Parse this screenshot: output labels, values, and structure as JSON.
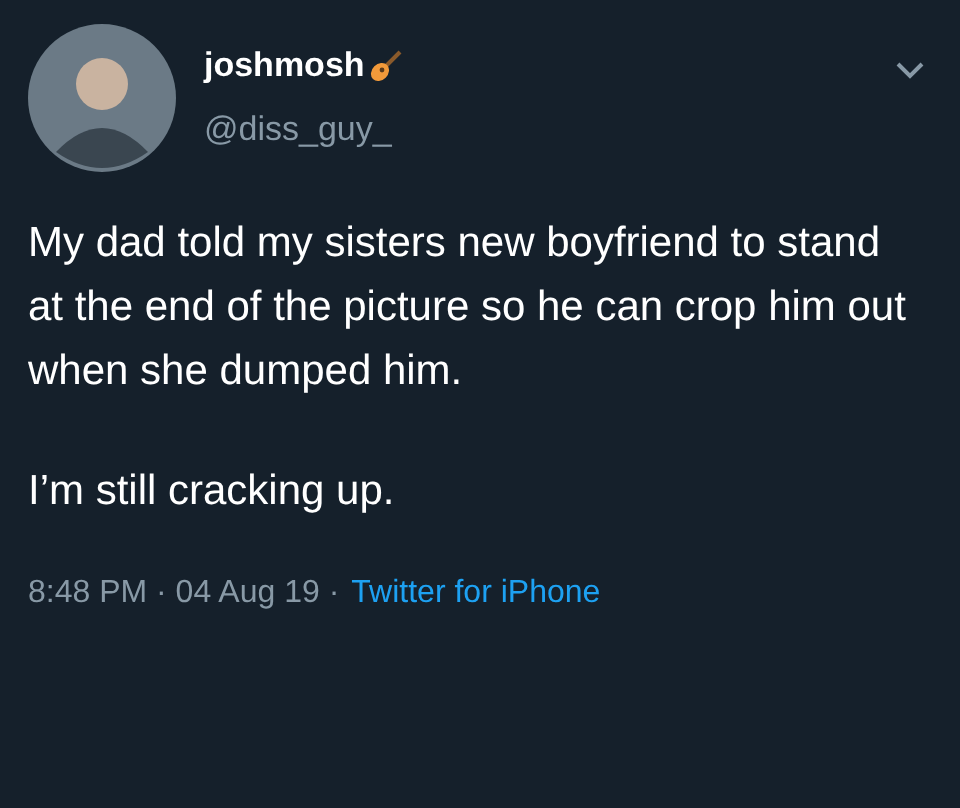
{
  "author": {
    "name": "joshmosh",
    "handle": "@diss_guy_"
  },
  "tweet": {
    "paragraphs": [
      "My dad told my sisters new boyfriend to stand at the end of the picture so he can crop him out when she dumped him.",
      "I’m still cracking up."
    ]
  },
  "meta": {
    "time": "8:48 PM · 04 Aug 19 ·",
    "source": "Twitter for iPhone"
  }
}
